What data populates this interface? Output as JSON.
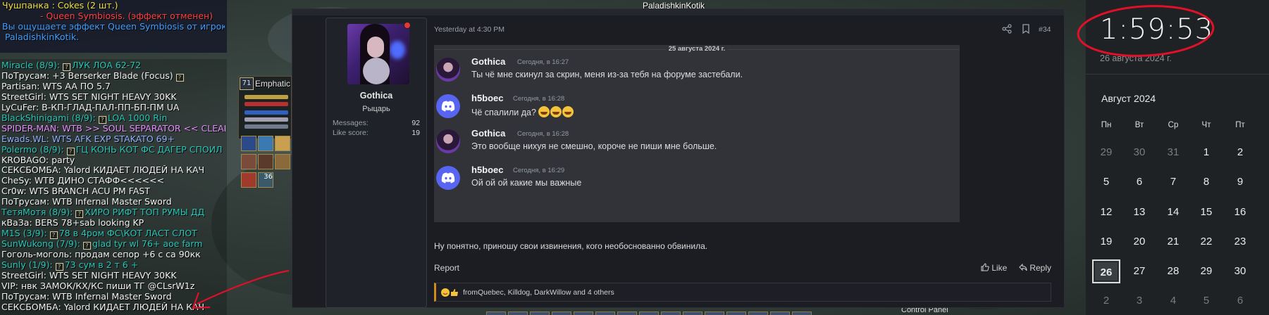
{
  "chat_top": [
    {
      "text": "Чушпанка : Cokes (2 шт.)",
      "color": "#f0e040"
    },
    {
      "text": "- Queen Symbiosis. (эффект отменен)",
      "color": "#ff4040"
    },
    {
      "text": "Вы ощущаете эффект Queen Symbiosis от игрока",
      "color": "#3f9fff"
    },
    {
      "text": "PaladishkinKotik.",
      "color": "#3f9fff"
    }
  ],
  "chat": [
    {
      "text": "Miracle (8/9):",
      "rest": "ЛУК ЛОА 62-72",
      "q": true,
      "color": "#27c7b9"
    },
    {
      "text": "ПоТрусам: +3 Berserker Blade (Focus)",
      "rest": "",
      "q": true,
      "qafter": true,
      "color": "#f2f2f2"
    },
    {
      "text": "Partisan: WTS AA ПО 5.7",
      "rest": "",
      "q": false,
      "color": "#f2f2f2"
    },
    {
      "text": "StreetGirl: WTS SET NIGHT HEAVY 30KK",
      "rest": "",
      "q": false,
      "color": "#f2f2f2"
    },
    {
      "text": "LyCuFer:  В-КП-ГЛАД-ПАЛ-ПП-БП-ПМ UA",
      "rest": "",
      "q": false,
      "color": "#f2f2f2"
    },
    {
      "text": "BlackShinigami (8/9):",
      "rest": "LOA 1000 Rin",
      "q": true,
      "color": "#27c7b9"
    },
    {
      "text": "SPIDER-MAN: WTB >> SOUL SEPARATOR << CLEAN",
      "rest": "",
      "q": false,
      "color": "#e58fff"
    },
    {
      "text": "Ewads.WL: WTS AFK EXP STAKATO 69+",
      "rest": "",
      "q": false,
      "color": "#8fb2ff"
    },
    {
      "text": "Polermo (8/9):",
      "rest": "ГЦ КОНЬ КОТ ФС ДАГЕР СПОИЛ",
      "q": true,
      "color": "#27c7b9"
    },
    {
      "text": "KROBAGO: party",
      "rest": "",
      "q": false,
      "color": "#f2f2f2"
    },
    {
      "text": "СЕКСБОМБА: Yalord КИДАЕТ ЛЮДЕЙ НА КАЧ",
      "rest": "",
      "q": false,
      "color": "#f2f2f2"
    },
    {
      "text": "CheSy: WTB ДИНО СТАФФ<<<<<<",
      "rest": "",
      "q": false,
      "color": "#f2f2f2"
    },
    {
      "text": "Cr0w: WTS BRANCH ACU PM FAST",
      "rest": "",
      "q": false,
      "color": "#f2f2f2"
    },
    {
      "text": "ПоТрусам: WTB Infernal Master Sword",
      "rest": "",
      "q": false,
      "color": "#f2f2f2"
    },
    {
      "text": "ТетяМотя (8/9):",
      "rest": "ХИРО РИФТ ТОП РУМЫ ДД",
      "q": true,
      "color": "#27c7b9"
    },
    {
      "text": "кВаЗа: BERS 78+sab looking KP",
      "rest": "",
      "q": false,
      "color": "#f2f2f2"
    },
    {
      "text": "M1S (3/9):",
      "rest": "78 в 4ром ФС\\КОТ ЛАСТ СЛОТ",
      "q": true,
      "color": "#27c7b9"
    },
    {
      "text": "SunWukong (7/9):",
      "rest": "glad tyr wl 76+ aoe farm",
      "q": true,
      "color": "#27c7b9"
    },
    {
      "text": "Гоголь-моголь: продам сепор +6 с са 90кк",
      "rest": "",
      "q": false,
      "color": "#f2f2f2"
    },
    {
      "text": "Sunly (1/9):",
      "rest": "73 сум в 2 т 6 +",
      "q": true,
      "color": "#27c7b9"
    },
    {
      "text": "StreetGirl: WTS SET NIGHT HEAVY 30KK",
      "rest": "",
      "q": false,
      "color": "#f2f2f2"
    },
    {
      "text": "VIP: нвк ЗАМОК/КХ/КС пиши ТГ @CLsrW1z",
      "rest": "",
      "q": false,
      "color": "#f2f2f2"
    },
    {
      "text": "ПоТрусам: WTB Infernal Master Sword",
      "rest": "",
      "q": false,
      "color": "#f2f2f2"
    },
    {
      "text": "СЕКСБОМБА: Yalord КИДАЕТ ЛЮДЕЙ НА КАЧ",
      "rest": "",
      "q": false,
      "color": "#f2f2f2"
    }
  ],
  "game": {
    "party_name": "Emphatic",
    "party_level": "71",
    "top_player": "PaladishkinKotik",
    "control_panel": "Control Panel",
    "buff_badge": "36"
  },
  "post": {
    "user": {
      "name": "Gothica",
      "title": "Рыцарь",
      "messages_label": "Messages:",
      "messages": "92",
      "like_label": "Like score:",
      "like_score": "19"
    },
    "date": "Yesterday at 4:30 PM",
    "number": "#34",
    "screenshot": {
      "date_divider": "25 августа 2024 г.",
      "messages": [
        {
          "author": "Gothica",
          "time": "Сегодня, в 16:27",
          "text": "Ты чё мне скинул за скрин, меня из-за тебя на форуме застебали.",
          "avatar": "gothica"
        },
        {
          "author": "h5boec",
          "time": "Сегодня, в 16:28",
          "text": "Чё спалили да?",
          "emojis": 3,
          "avatar": "discord"
        },
        {
          "author": "Gothica",
          "time": "Сегодня, в 16:28",
          "text": "Это вообще нихуя не смешно, короче не пиши мне больше.",
          "avatar": "gothica"
        },
        {
          "author": "h5boec",
          "time": "Сегодня, в 16:29",
          "text": "Ой ой ой какие мы важные",
          "avatar": "discord"
        }
      ]
    },
    "body": "Ну понятно, приношу свои извинения, кого необоснованно обвинила.",
    "report_label": "Report",
    "like_label": "Like",
    "reply_label": "Reply",
    "reactions_text": "fromQuebec, Killdog, DarkWillow and 4 others"
  },
  "calendar": {
    "time": "1:59:53",
    "date": "26 августа 2024 г.",
    "month": "Август 2024",
    "weekdays": [
      "Пн",
      "Вт",
      "Ср",
      "Чт",
      "Пт"
    ],
    "weeks": [
      [
        "29",
        "30",
        "31",
        "1",
        "2"
      ],
      [
        "5",
        "6",
        "7",
        "8",
        "9"
      ],
      [
        "12",
        "13",
        "14",
        "15",
        "16"
      ],
      [
        "19",
        "20",
        "21",
        "22",
        "23"
      ],
      [
        "26",
        "27",
        "28",
        "29",
        "30"
      ],
      [
        "2",
        "3",
        "4",
        "5",
        "6"
      ]
    ],
    "muted": [
      "0-0",
      "0-1",
      "0-2",
      "5-0",
      "5-1",
      "5-2",
      "5-3",
      "5-4"
    ],
    "today": "4-0"
  },
  "colors": {
    "annotation_red": "#e0102a",
    "forum_bg": "#1b1d22",
    "discord_bg": "#313338",
    "accent_orange": "#d18b1d"
  }
}
